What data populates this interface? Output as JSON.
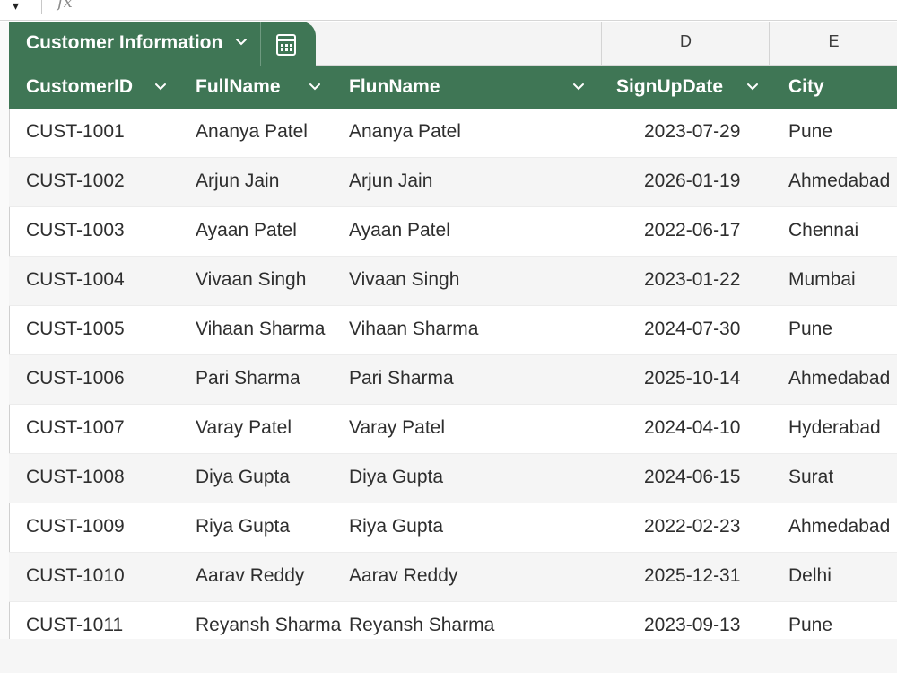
{
  "formula_bar": {
    "fx_label": "fx"
  },
  "columns": {
    "d_label": "D",
    "e_label": "E"
  },
  "table": {
    "title": "Customer Information",
    "headers": [
      "CustomerID",
      "FullName",
      "FlunName",
      "SignUpDate",
      "City"
    ]
  },
  "rows": [
    [
      "CUST-1001",
      "Ananya Patel",
      "Ananya Patel",
      "2023-07-29",
      "Pune"
    ],
    [
      "CUST-1002",
      "Arjun Jain",
      "Arjun Jain",
      "2026-01-19",
      "Ahmedabad"
    ],
    [
      "CUST-1003",
      "Ayaan Patel",
      "Ayaan Patel",
      "2022-06-17",
      "Chennai"
    ],
    [
      "CUST-1004",
      "Vivaan Singh",
      "Vivaan Singh",
      "2023-01-22",
      "Mumbai"
    ],
    [
      "CUST-1005",
      "Vihaan Sharma",
      "Vihaan Sharma",
      "2024-07-30",
      "Pune"
    ],
    [
      "CUST-1006",
      "Pari Sharma",
      "Pari Sharma",
      "2025-10-14",
      "Ahmedabad"
    ],
    [
      "CUST-1007",
      "Varay Patel",
      "Varay Patel",
      "2024-04-10",
      "Hyderabad"
    ],
    [
      "CUST-1008",
      "Diya Gupta",
      "Diya Gupta",
      "2024-06-15",
      "Surat"
    ],
    [
      "CUST-1009",
      "Riya Gupta",
      "Riya Gupta",
      "2022-02-23",
      "Ahmedabad"
    ],
    [
      "CUST-1010",
      "Aarav Reddy",
      "Aarav Reddy",
      "2025-12-31",
      "Delhi"
    ],
    [
      "CUST-1011",
      "Reyansh Sharma",
      "Reyansh Sharma",
      "2023-09-13",
      "Pune"
    ]
  ],
  "icons": {
    "formula_dropdown": "chevron-down-icon",
    "table_menu": "chevron-down-icon",
    "table_calc": "calculator-icon",
    "header_filter": "chevron-down-icon"
  },
  "colors": {
    "table_header": "#3f7655",
    "header_text": "#ffffff",
    "alt_row": "#f5f5f5"
  }
}
